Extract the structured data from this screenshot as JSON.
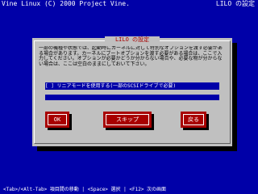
{
  "header": {
    "title": "Vine Linux (C) 2000 Project Vine.",
    "right_label": "LILO の設定"
  },
  "dialog": {
    "title": "LILO の設定",
    "body": "一部の機種や状態では、起動時にカーネルに対して特別なオプションを渡す必要がある場合があります。カーネルにブートオプションを渡す必要がある場合は、ここで入力してください。オプションが必要かどうか分からない場合や、必要な物が分からない場合は、ここは空白のままにしておいて下さい。",
    "option_label": "[ ] リニアモードを使用する(一部のSCSIドライブで必要)",
    "input_value": "",
    "buttons": {
      "ok": "OK",
      "skip": "スキップ",
      "back": "戻る"
    }
  },
  "footer": {
    "hint": "<Tab>/<Alt-Tab> 項目間の移動 | <Space> 選択 | <F12> 次の画面"
  },
  "colors": {
    "background": "#0000a8",
    "dialog": "#c0c0c0",
    "button": "#a80000",
    "title_text": "#a80000"
  }
}
